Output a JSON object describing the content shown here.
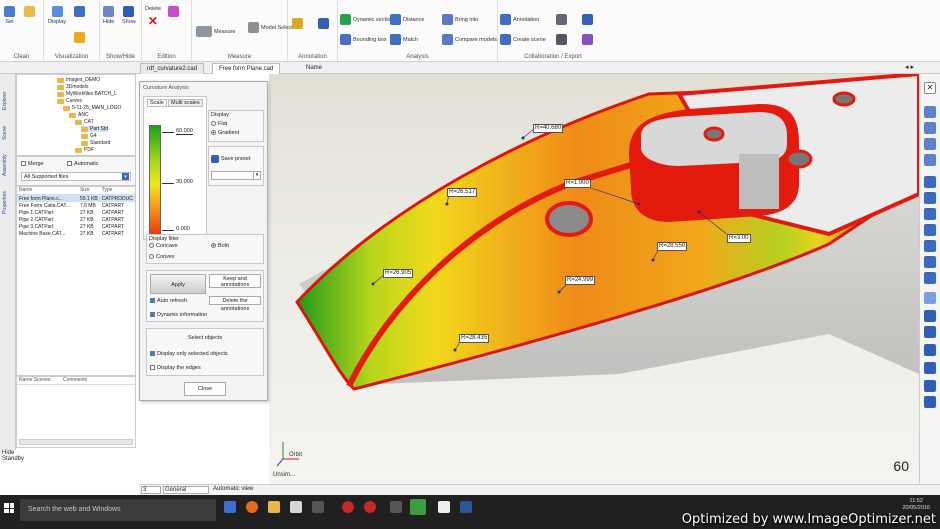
{
  "ribbon": {
    "groups": [
      "Clean",
      "Visualization",
      "Show/Hide",
      "Edition",
      "Measure",
      "Annotation",
      "Analysis",
      "Collaboration / Export"
    ],
    "buttons": {
      "set": "Set",
      "display": "Display",
      "hide": "Hide",
      "show": "Show",
      "delete": "Delete",
      "measure": "Measure",
      "model_select": "Model Select",
      "dynamic_section": "Dynamic section",
      "bounding_box": "Bounding box",
      "distance": "Distance",
      "bring_into": "Bring into",
      "match": "Match",
      "compare_models": "Compare models",
      "annotation": "Annotation",
      "create_scene": "Create scene"
    }
  },
  "tabs": [
    "rdf_curvature2.cad",
    "Free form Plane.cad",
    "Name"
  ],
  "left_vtabs": [
    "Explorer",
    "Scene",
    "Assembly",
    "Properties"
  ],
  "tree": [
    {
      "label": "Images_DEMO",
      "indent": 0
    },
    {
      "label": "3Dmodels",
      "indent": 0
    },
    {
      "label": "MyWorkfiles BATCH_L",
      "indent": 0
    },
    {
      "label": "Curves",
      "indent": 0
    },
    {
      "label": "5-11-25_MAIN_LOGO",
      "indent": 1
    },
    {
      "label": "ANC",
      "indent": 2
    },
    {
      "label": "CAT",
      "indent": 3
    },
    {
      "label": "Part Std",
      "indent": 4
    },
    {
      "label": "G4",
      "indent": 4
    },
    {
      "label": "Standard",
      "indent": 4
    },
    {
      "label": "PDF",
      "indent": 3
    }
  ],
  "filter": {
    "merge_label": "Merge",
    "automatic_label": "Automatic",
    "type_label": "All Supported files"
  },
  "filelist": {
    "headers": [
      "Name",
      "Size",
      "Type"
    ],
    "rows": [
      [
        "Free form Plane.c...",
        "59.1 KB",
        "CATPRODUC"
      ],
      [
        "Free Form Catia.CAT...",
        "7.6 MB",
        "CATPART"
      ],
      [
        "Pipe 1.CATPart",
        "27 KB",
        "CATPART"
      ],
      [
        "Pipe 2.CATPart",
        "27 KB",
        "CATPART"
      ],
      [
        "Pipe 3.CATPart",
        "27 KB",
        "CATPART"
      ],
      [
        "Machine Base.CAT...",
        "27 KB",
        "CATPART"
      ]
    ]
  },
  "props": {
    "headers": [
      "Name Scenes",
      "Comments"
    ]
  },
  "status_left": {
    "title": "Hide",
    "value": "Standby"
  },
  "dialog": {
    "title": "Curvature Analysis",
    "scale_tab1": "Scale",
    "scale_tab2": "Multi scales",
    "scale_top": "60.000",
    "scale_mid": "30.000",
    "scale_bot": "0.000",
    "display_label": "Display",
    "flat_label": "Flat",
    "gradient_label": "Gradient",
    "setpreset_label": "Save preset",
    "display_filter": "Display filter",
    "concave": "Concave",
    "both": "Both",
    "convex": "Convex",
    "apply": "Apply",
    "keep_annotations": "Keep and annotations",
    "auto_refresh": "Auto refresh",
    "delete_annotations": "Delete the annotations",
    "dynamic_info": "Dynamic information",
    "select_objects": "Select objects",
    "display_only_selected": "Display only selected objects",
    "display_edges": "Display the edges",
    "close": "Close"
  },
  "annotations": [
    "R=40.680",
    "R=26.517",
    "R=1.000",
    "R=3.00",
    "R=28.550",
    "R=24.999",
    "R=26.905",
    "R=28.435"
  ],
  "viewport": {
    "fps": "60",
    "axis_label": "Orbit",
    "status": "Unsim..."
  },
  "cmdbar": {
    "field1": "3",
    "field2": "General",
    "message": "Automatic view"
  },
  "taskbar": {
    "search_placeholder": "Search the web and Windows",
    "time": "11:52",
    "date": "20/05/2016"
  },
  "watermark": "Optimized by www.ImageOptimizer.net",
  "colors": {
    "accent": "#1c4a9c",
    "red": "#e31a0e",
    "green": "#1b9a1b",
    "yellow": "#f2e51c"
  }
}
